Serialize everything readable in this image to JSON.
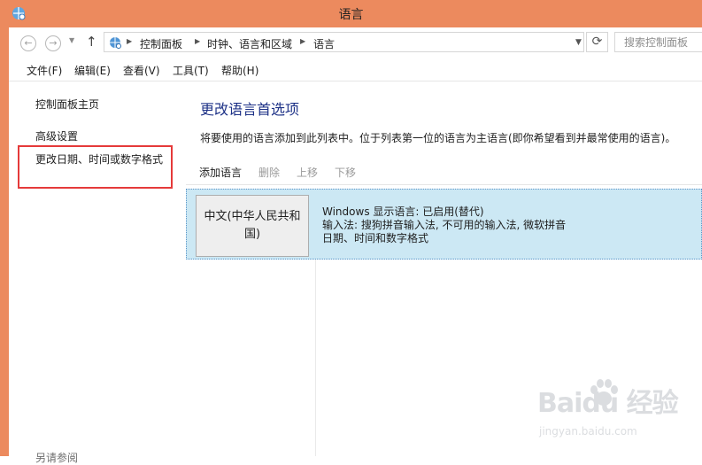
{
  "window": {
    "title": "语言"
  },
  "address": {
    "breadcrumbs": [
      "控制面板",
      "时钟、语言和区域",
      "语言"
    ],
    "search_placeholder": "搜索控制面板"
  },
  "menubar": {
    "items": [
      "文件(F)",
      "编辑(E)",
      "查看(V)",
      "工具(T)",
      "帮助(H)"
    ]
  },
  "sidebar": {
    "home": "控制面板主页",
    "links": [
      "高级设置",
      "更改日期、时间或数字格式"
    ],
    "see_also": "另请参阅"
  },
  "main": {
    "title": "更改语言首选项",
    "description": "将要使用的语言添加到此列表中。位于列表第一位的语言为主语言(即你希望看到并最常使用的语言)。",
    "toolbar": {
      "add": "添加语言",
      "remove": "删除",
      "move_up": "上移",
      "move_down": "下移"
    },
    "languages": [
      {
        "name": "中文(中华人民共和国)",
        "details": [
          "Windows 显示语言: 已启用(替代)",
          "输入法: 搜狗拼音输入法, 不可用的输入法, 微软拼音",
          "日期、时间和数字格式"
        ]
      }
    ]
  },
  "watermark": {
    "text": "Baidu 经验",
    "sub": "jingyan.baidu.com"
  },
  "colors": {
    "titlebar": "#ec8a5e",
    "selection": "#cce8f4",
    "highlight_border": "#e53a3a",
    "title_text": "#1e3287"
  }
}
